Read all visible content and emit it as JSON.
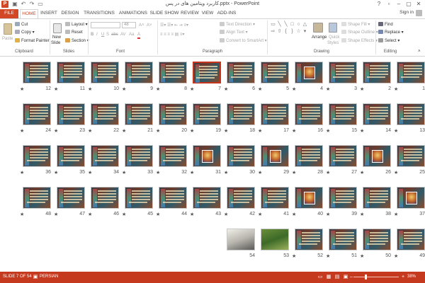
{
  "window": {
    "title": "کاربرد ویتامین های در پس.pptx - PowerPoint",
    "app_icon": "P",
    "controls": [
      "?",
      "▫",
      "–",
      "▢",
      "✕"
    ]
  },
  "quick_access": [
    "save-icon",
    "undo-icon",
    "redo-icon",
    "start-from-beginning-icon"
  ],
  "tabs": [
    "FILE",
    "HOME",
    "INSERT",
    "DESIGN",
    "TRANSITIONS",
    "ANIMATIONS",
    "SLIDE SHOW",
    "REVIEW",
    "VIEW",
    "ADD-INS"
  ],
  "active_tab": "HOME",
  "account": {
    "sign_in": "Sign in"
  },
  "ribbon": {
    "clipboard": {
      "label": "Clipboard",
      "paste": "Paste",
      "cut": "Cut",
      "copy": "Copy",
      "format_painter": "Format Painter"
    },
    "slides": {
      "label": "Slides",
      "new_slide": "New",
      "new_slide_2": "Slide",
      "layout": "Layout",
      "reset": "Reset",
      "section": "Section"
    },
    "font": {
      "label": "Font",
      "font_name": "",
      "font_size": "48",
      "buttons": [
        "B",
        "I",
        "U",
        "S",
        "abc",
        "AV",
        "Aa",
        "A"
      ]
    },
    "paragraph": {
      "label": "Paragraph",
      "text_direction": "Text Direction",
      "align_text": "Align Text",
      "convert_smartart": "Convert to SmartArt"
    },
    "drawing": {
      "label": "Drawing",
      "arrange": "Arrange",
      "quick_styles": "Quick",
      "quick_styles_2": "Styles",
      "shape_fill": "Shape Fill",
      "shape_outline": "Shape Outline",
      "shape_effects": "Shape Effects"
    },
    "editing": {
      "label": "Editing",
      "find": "Find",
      "replace": "Replace",
      "select": "Select"
    }
  },
  "slides": [
    {
      "n": "1"
    },
    {
      "n": "2"
    },
    {
      "n": "3"
    },
    {
      "n": "4"
    },
    {
      "n": "5"
    },
    {
      "n": "6"
    },
    {
      "n": "7",
      "selected": true
    },
    {
      "n": "8"
    },
    {
      "n": "9"
    },
    {
      "n": "10"
    },
    {
      "n": "11"
    },
    {
      "n": "12"
    },
    {
      "n": "13"
    },
    {
      "n": "14"
    },
    {
      "n": "15"
    },
    {
      "n": "16"
    },
    {
      "n": "17"
    },
    {
      "n": "18"
    },
    {
      "n": "19"
    },
    {
      "n": "20"
    },
    {
      "n": "21"
    },
    {
      "n": "22"
    },
    {
      "n": "23"
    },
    {
      "n": "24"
    },
    {
      "n": "25"
    },
    {
      "n": "26"
    },
    {
      "n": "27"
    },
    {
      "n": "28"
    },
    {
      "n": "29"
    },
    {
      "n": "30"
    },
    {
      "n": "31"
    },
    {
      "n": "32"
    },
    {
      "n": "33"
    },
    {
      "n": "34"
    },
    {
      "n": "35"
    },
    {
      "n": "36"
    },
    {
      "n": "37"
    },
    {
      "n": "38"
    },
    {
      "n": "39"
    },
    {
      "n": "40"
    },
    {
      "n": "41"
    },
    {
      "n": "42"
    },
    {
      "n": "43"
    },
    {
      "n": "44"
    },
    {
      "n": "45"
    },
    {
      "n": "46"
    },
    {
      "n": "47"
    },
    {
      "n": "48"
    },
    {
      "n": "49"
    },
    {
      "n": "50"
    },
    {
      "n": "51"
    },
    {
      "n": "52"
    },
    {
      "n": "53"
    },
    {
      "n": "54"
    }
  ],
  "statusbar": {
    "slide_info": "SLIDE 7 OF 54",
    "language": "PERSIAN",
    "zoom": "38%"
  },
  "colors": {
    "accent": "#d24726",
    "statusbar": "#c5391e",
    "selection": "#c5341b"
  }
}
